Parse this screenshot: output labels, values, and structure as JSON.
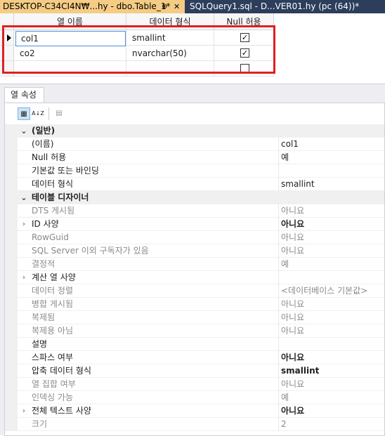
{
  "tabs": {
    "active_title": "DESKTOP-C34CI4N₩...hy - dbo.Table_1*",
    "pin_glyph": "⊕",
    "close_glyph": "✕",
    "inactive_title": "SQLQuery1.sql - D...VER01.hy (pc (64))*"
  },
  "grid": {
    "headers": [
      "열 이름",
      "데이터 형식",
      "Null 허용"
    ],
    "rows": [
      {
        "name": "col1",
        "type": "smallint",
        "nullable": "✓"
      },
      {
        "name": "co2",
        "type": "nvarchar(50)",
        "nullable": "✓"
      },
      {
        "name": "",
        "type": "",
        "nullable": ""
      }
    ]
  },
  "props": {
    "tab_label": "열 속성",
    "toolbar": {
      "categorized": "▦",
      "alphabetical": "A↓Z",
      "pages": "▤"
    },
    "rows": [
      {
        "kind": "cat",
        "name": "(일반)",
        "value": "",
        "expander": "⌄"
      },
      {
        "kind": "prop",
        "name": "(이름)",
        "value": "col1"
      },
      {
        "kind": "prop",
        "name": "Null 허용",
        "value": "예"
      },
      {
        "kind": "prop",
        "name": "기본값 또는 바인딩",
        "value": ""
      },
      {
        "kind": "prop",
        "name": "데이터 형식",
        "value": "smallint"
      },
      {
        "kind": "cat",
        "name": "테이블 디자이너",
        "value": "",
        "expander": "⌄"
      },
      {
        "kind": "prop",
        "name": "DTS 게시됨",
        "value": "아니요",
        "style": "gray"
      },
      {
        "kind": "prop",
        "name": "ID 사양",
        "value": "아니요",
        "expander": "›",
        "style": "boldval"
      },
      {
        "kind": "prop",
        "name": "RowGuid",
        "value": "아니요",
        "style": "gray"
      },
      {
        "kind": "prop",
        "name": "SQL Server 이외 구독자가 있음",
        "value": "아니요",
        "style": "gray"
      },
      {
        "kind": "prop",
        "name": "결정적",
        "value": "예",
        "style": "gray"
      },
      {
        "kind": "prop",
        "name": "계산 열 사양",
        "value": "",
        "expander": "›"
      },
      {
        "kind": "prop",
        "name": "데이터 정렬",
        "value": "<데이터베이스 기본값>",
        "style": "gray"
      },
      {
        "kind": "prop",
        "name": "병합 게시됨",
        "value": "아니요",
        "style": "gray"
      },
      {
        "kind": "prop",
        "name": "복제됨",
        "value": "아니요",
        "style": "gray"
      },
      {
        "kind": "prop",
        "name": "복제용 아님",
        "value": "아니요",
        "style": "gray"
      },
      {
        "kind": "prop",
        "name": "설명",
        "value": ""
      },
      {
        "kind": "prop",
        "name": "스파스 여부",
        "value": "아니요",
        "style": "boldval"
      },
      {
        "kind": "prop",
        "name": "압축 데이터 형식",
        "value": "smallint",
        "style": "boldval"
      },
      {
        "kind": "prop",
        "name": "열 집합 여부",
        "value": "아니요",
        "style": "gray"
      },
      {
        "kind": "prop",
        "name": "인덱싱 가능",
        "value": "예",
        "style": "gray"
      },
      {
        "kind": "prop",
        "name": "전체 텍스트 사양",
        "value": "아니요",
        "expander": "›",
        "style": "boldval"
      },
      {
        "kind": "prop",
        "name": "크기",
        "value": "2",
        "style": "gray"
      }
    ]
  }
}
